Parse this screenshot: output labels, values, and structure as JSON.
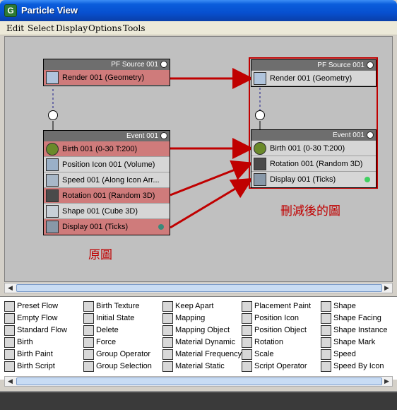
{
  "window": {
    "title": "Particle View",
    "app_icon": "3ds-max-logo-icon"
  },
  "menu": [
    "Edit",
    "Select",
    "Display",
    "Options",
    "Tools"
  ],
  "original": {
    "source": {
      "title": "PF Source 001",
      "op": "Render 001 (Geometry)"
    },
    "event": {
      "title": "Event 001",
      "ops": [
        {
          "label": "Birth 001 (0-30 T:200)",
          "icon": "birth-icon",
          "state": "red"
        },
        {
          "label": "Position Icon 001 (Volume)",
          "icon": "position-icon",
          "state": "gray"
        },
        {
          "label": "Speed 001 (Along Icon Arr...",
          "icon": "speed-icon",
          "state": "gray"
        },
        {
          "label": "Rotation 001 (Random 3D)",
          "icon": "rotation-icon",
          "state": "red"
        },
        {
          "label": "Shape 001 (Cube 3D)",
          "icon": "shape-icon",
          "state": "gray"
        },
        {
          "label": "Display 001 (Ticks)",
          "icon": "display-icon",
          "state": "red"
        }
      ]
    },
    "display_dot_color": "#3a8a7a"
  },
  "pruned": {
    "source": {
      "title": "PF Source 001",
      "op": "Render 001 (Geometry)"
    },
    "event": {
      "title": "Event 001",
      "ops": [
        {
          "label": "Birth 001 (0-30 T:200)",
          "icon": "birth-icon"
        },
        {
          "label": "Rotation 001 (Random 3D)",
          "icon": "rotation-icon"
        },
        {
          "label": "Display 001 (Ticks)",
          "icon": "display-icon"
        }
      ]
    },
    "display_dot_color": "#40d060"
  },
  "annotations": {
    "original": "原圖",
    "pruned": "刪減後的圖",
    "color": "#c00000"
  },
  "depot": {
    "columns": [
      [
        "Preset Flow",
        "Empty Flow",
        "Standard Flow",
        "Birth",
        "Birth Paint",
        "Birth Script"
      ],
      [
        "Birth Texture",
        "Initial State",
        "Delete",
        "Force",
        "Group Operator",
        "Group Selection"
      ],
      [
        "Keep Apart",
        "Mapping",
        "Mapping Object",
        "Material Dynamic",
        "Material Frequency",
        "Material Static"
      ],
      [
        "Placement Paint",
        "Position Icon",
        "Position Object",
        "Rotation",
        "Scale",
        "Script Operator"
      ],
      [
        "Shape",
        "Shape Facing",
        "Shape Instance",
        "Shape Mark",
        "Speed",
        "Speed By Icon"
      ]
    ]
  }
}
